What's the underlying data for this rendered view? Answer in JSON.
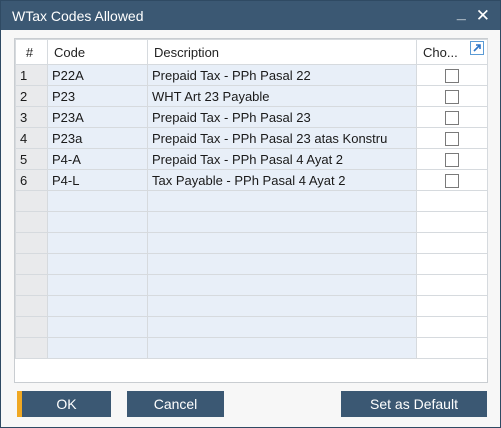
{
  "window": {
    "title": "WTax Codes Allowed"
  },
  "grid": {
    "columns": {
      "num": "#",
      "code": "Code",
      "description": "Description",
      "chosen": "Cho..."
    },
    "rows": [
      {
        "num": "1",
        "code": "P22A",
        "description": "Prepaid Tax - PPh Pasal 22",
        "chosen": false
      },
      {
        "num": "2",
        "code": "P23",
        "description": "WHT Art 23 Payable",
        "chosen": false
      },
      {
        "num": "3",
        "code": "P23A",
        "description": "Prepaid Tax - PPh Pasal 23",
        "chosen": false
      },
      {
        "num": "4",
        "code": "P23a",
        "description": "Prepaid Tax - PPh Pasal 23 atas Konstru",
        "chosen": false
      },
      {
        "num": "5",
        "code": "P4-A",
        "description": "Prepaid Tax - PPh Pasal 4 Ayat 2",
        "chosen": false
      },
      {
        "num": "6",
        "code": "P4-L",
        "description": "Tax Payable - PPh Pasal 4 Ayat 2",
        "chosen": false
      }
    ],
    "blank_rows": 8
  },
  "buttons": {
    "ok": "OK",
    "cancel": "Cancel",
    "set_default": "Set as Default"
  },
  "icons": {
    "minimize": "minimize-icon",
    "close": "close-icon",
    "expand": "expand-arrow-icon"
  },
  "colors": {
    "titlebar": "#3b5873",
    "button": "#3b5873",
    "ok_accent": "#f0a823",
    "row_fill": "#e8eff8"
  }
}
